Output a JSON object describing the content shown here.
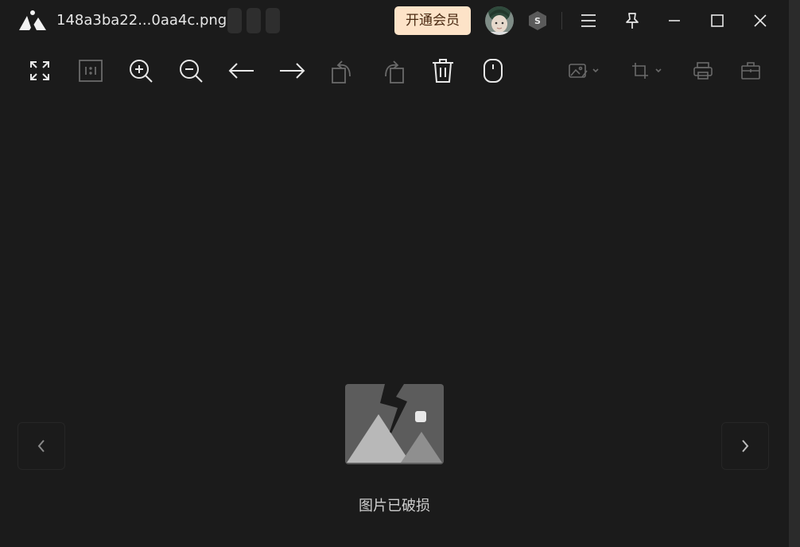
{
  "titlebar": {
    "filename": "148a3ba22...0aa4c.png",
    "vip_label": "开通会员",
    "icons": [
      "app-logo-icon",
      "avatar",
      "s-badge-icon",
      "menu-icon",
      "pin-icon",
      "minimize-icon",
      "maximize-icon",
      "close-icon"
    ]
  },
  "toolbar": {
    "tools": [
      {
        "name": "fullscreen-icon",
        "enabled": true
      },
      {
        "name": "actual-size-icon",
        "enabled": false
      },
      {
        "name": "zoom-in-icon",
        "enabled": true
      },
      {
        "name": "zoom-out-icon",
        "enabled": true
      },
      {
        "name": "previous-arrow-icon",
        "enabled": true
      },
      {
        "name": "next-arrow-icon",
        "enabled": true
      },
      {
        "name": "rotate-left-icon",
        "enabled": false
      },
      {
        "name": "rotate-right-icon",
        "enabled": false
      },
      {
        "name": "delete-icon",
        "enabled": true
      },
      {
        "name": "mouse-icon",
        "enabled": true
      },
      {
        "name": "image-edit-icon",
        "enabled": false
      },
      {
        "name": "crop-icon",
        "enabled": false
      },
      {
        "name": "print-icon",
        "enabled": false
      },
      {
        "name": "toolbox-icon",
        "enabled": false
      }
    ]
  },
  "viewer": {
    "status_text": "图片已破损",
    "prev_icon": "chevron-left-icon",
    "next_icon": "chevron-right-icon"
  },
  "colors": {
    "background": "#1b1b1b",
    "vip_bg": "#fde3c8",
    "vip_text": "#4a2a12",
    "icon_active": "#e8e8e8",
    "icon_disabled": "#6a6a6a"
  }
}
